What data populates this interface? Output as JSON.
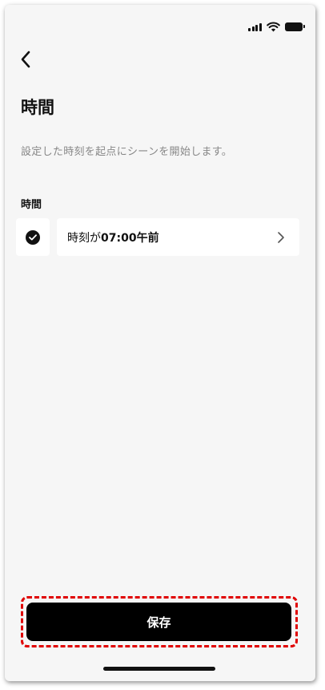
{
  "header": {
    "title": "時間",
    "description": "設定した時刻を起点にシーンを開始します。"
  },
  "time_section": {
    "label": "時間",
    "condition_prefix": "時刻が",
    "condition_value": "07:00午前"
  },
  "save_label": "保存",
  "icons": {
    "back": "chevron-left-icon",
    "check": "check-circle-icon",
    "row_chevron": "chevron-right-icon",
    "signal": "cellular-signal-icon",
    "wifi": "wifi-icon",
    "battery": "battery-icon"
  },
  "colors": {
    "highlight": "#e00000",
    "button": "#000000",
    "background": "#f6f6f6"
  }
}
